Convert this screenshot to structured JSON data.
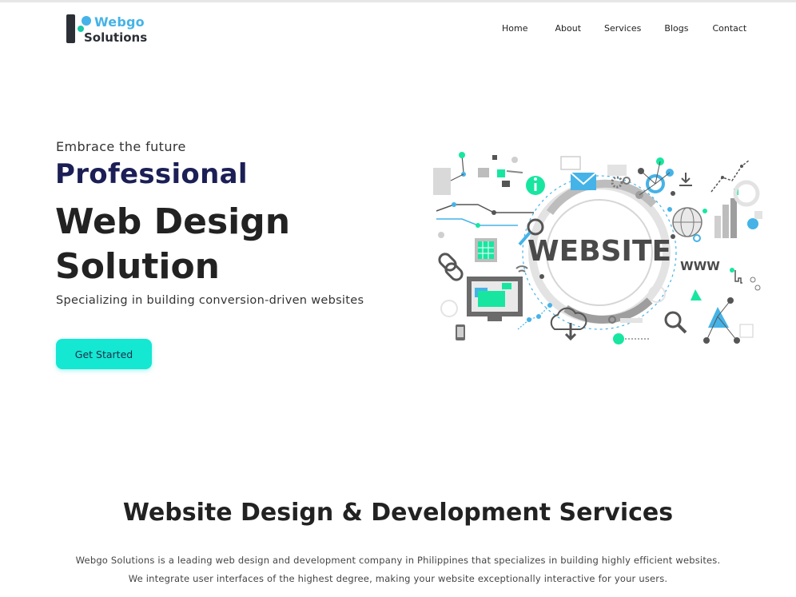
{
  "brand": {
    "name_line1": "Webgo",
    "name_line2": "Solutions"
  },
  "nav": [
    {
      "label": "Home"
    },
    {
      "label": "About"
    },
    {
      "label": "Services"
    },
    {
      "label": "Blogs"
    },
    {
      "label": "Contact"
    }
  ],
  "hero": {
    "eyebrow": "Embrace the future",
    "highlight": "Professional",
    "title_line1": "Web Design",
    "title_line2": "Solution",
    "subtitle": "Specializing in building conversion-driven websites",
    "cta_label": "Get Started",
    "illustration_text": "WEBSITE",
    "illustration_www": "WWW"
  },
  "services": {
    "title": "Website Design & Development Services",
    "paragraph_line1": "Webgo Solutions is a leading web design and development company in Philippines that specializes in building highly efficient websites.",
    "paragraph_line2": "We integrate user interfaces of the highest degree, making your website exceptionally interactive for your users."
  },
  "colors": {
    "accent": "#14e7d2",
    "brand_blue": "#45b3e7",
    "brand_green": "#18c9a8",
    "heading_navy": "#1b1f55",
    "dark": "#222222"
  }
}
